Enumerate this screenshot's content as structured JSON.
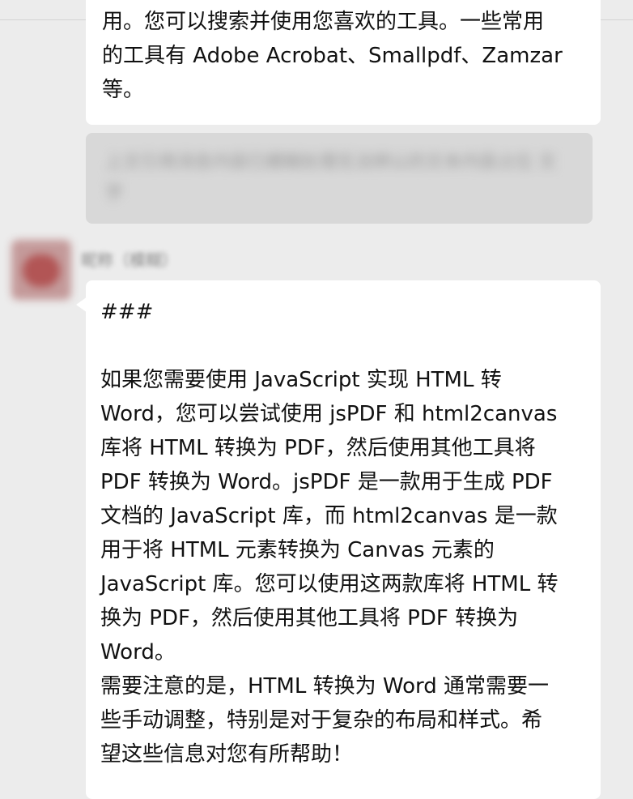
{
  "message_prev": {
    "lines": [
      "用。您可以搜索并使用您喜欢的工具。一些常用",
      "的工具有 Adobe Acrobat、Smallpdf、Zamzar",
      "等。"
    ]
  },
  "quoted_message": {
    "blurred_text": "上文引用消息内容已模糊处理无法辨认的文本内容占位 文字"
  },
  "sender": {
    "name": "昵称（模糊）"
  },
  "message_main": {
    "heading": "###",
    "lines": [
      "如果您需要使用 JavaScript 实现 HTML 转",
      "Word，您可以尝试使用 jsPDF 和 html2canvas",
      "库将 HTML 转换为 PDF，然后使用其他工具将",
      "PDF 转换为 Word。jsPDF 是一款用于生成 PDF",
      "文档的 JavaScript 库，而 html2canvas 是一款",
      "用于将 HTML 元素转换为 Canvas 元素的",
      "JavaScript 库。您可以使用这两款库将 HTML 转",
      "换为 PDF，然后使用其他工具将 PDF 转换为",
      "Word。",
      "需要注意的是，HTML 转换为 Word 通常需要一",
      "些手动调整，特别是对于复杂的布局和样式。希",
      "望这些信息对您有所帮助！"
    ]
  }
}
